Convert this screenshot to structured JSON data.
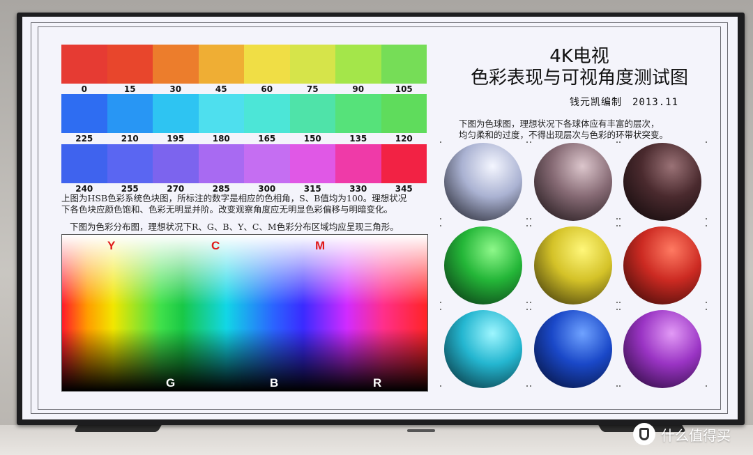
{
  "hue_rows": [
    {
      "labels": [
        "0",
        "15",
        "30",
        "45",
        "60",
        "75",
        "90",
        "105"
      ],
      "colors": [
        "#e63b33",
        "#e8462c",
        "#ec7d2c",
        "#efae34",
        "#f0de45",
        "#d6e44a",
        "#a4e64a",
        "#76dd57"
      ]
    },
    {
      "labels": [
        "225",
        "210",
        "195",
        "180",
        "165",
        "150",
        "135",
        "120"
      ],
      "colors": [
        "#2e6df2",
        "#2896f4",
        "#2ec4f2",
        "#4edfee",
        "#4ce6d7",
        "#4fe3a9",
        "#56e27a",
        "#5fdc5c"
      ]
    },
    {
      "labels": [
        "240",
        "255",
        "270",
        "285",
        "300",
        "315",
        "330",
        "345"
      ],
      "colors": [
        "#3f63ee",
        "#5a66f2",
        "#7c64ee",
        "#a86af2",
        "#c56ef2",
        "#e058e6",
        "#ef3aa8",
        "#f22244"
      ]
    }
  ],
  "hsb_description": [
    "上图为HSB色彩系统色块图，所标注的数字是相应的色相角，S、B值均为100。理想状况",
    "下各色块应颜色饱和、色彩无明显并阶。改变观察角度应无明显色彩偏移与明暗变化。"
  ],
  "gamut_description": "下图为色彩分布图，理想状况下R、G、B、Y、C、M色彩分布区域均应呈现三角形。",
  "gamut_labels_top": [
    "Y",
    "C",
    "M"
  ],
  "gamut_labels_bottom": [
    "G",
    "B",
    "R"
  ],
  "title_line1": "4K电视",
  "title_line2": "色彩表现与可视角度测试图",
  "author": "钱元凯编制　2013.11",
  "sphere_description": [
    "下图为色球图，理想状况下各球体应有丰富的层次，",
    "均匀柔和的过度，不得出现层次与色彩的环带状突变。"
  ],
  "spheres": [
    {
      "name": "white",
      "base": "#aab2d2",
      "light": "#f4f6ff",
      "dark": "#111118"
    },
    {
      "name": "pink-gray",
      "base": "#866a74",
      "light": "#dcc6cc",
      "dark": "#100a0c"
    },
    {
      "name": "brown",
      "base": "#4a2a2e",
      "light": "#9a7276",
      "dark": "#080405"
    },
    {
      "name": "green",
      "base": "#24b638",
      "light": "#8ef88a",
      "dark": "#062410"
    },
    {
      "name": "yellow",
      "base": "#d4c228",
      "light": "#fff77a",
      "dark": "#2a2406"
    },
    {
      "name": "red",
      "base": "#cc2a22",
      "light": "#ff7a62",
      "dark": "#2a0604"
    },
    {
      "name": "cyan",
      "base": "#24b6d0",
      "light": "#9ef6ff",
      "dark": "#042028"
    },
    {
      "name": "blue",
      "base": "#1a48c8",
      "light": "#6fa2ff",
      "dark": "#020a28"
    },
    {
      "name": "purple",
      "base": "#9a34c4",
      "light": "#e29af6",
      "dark": "#1a0428"
    }
  ],
  "watermark": "什么值得买"
}
